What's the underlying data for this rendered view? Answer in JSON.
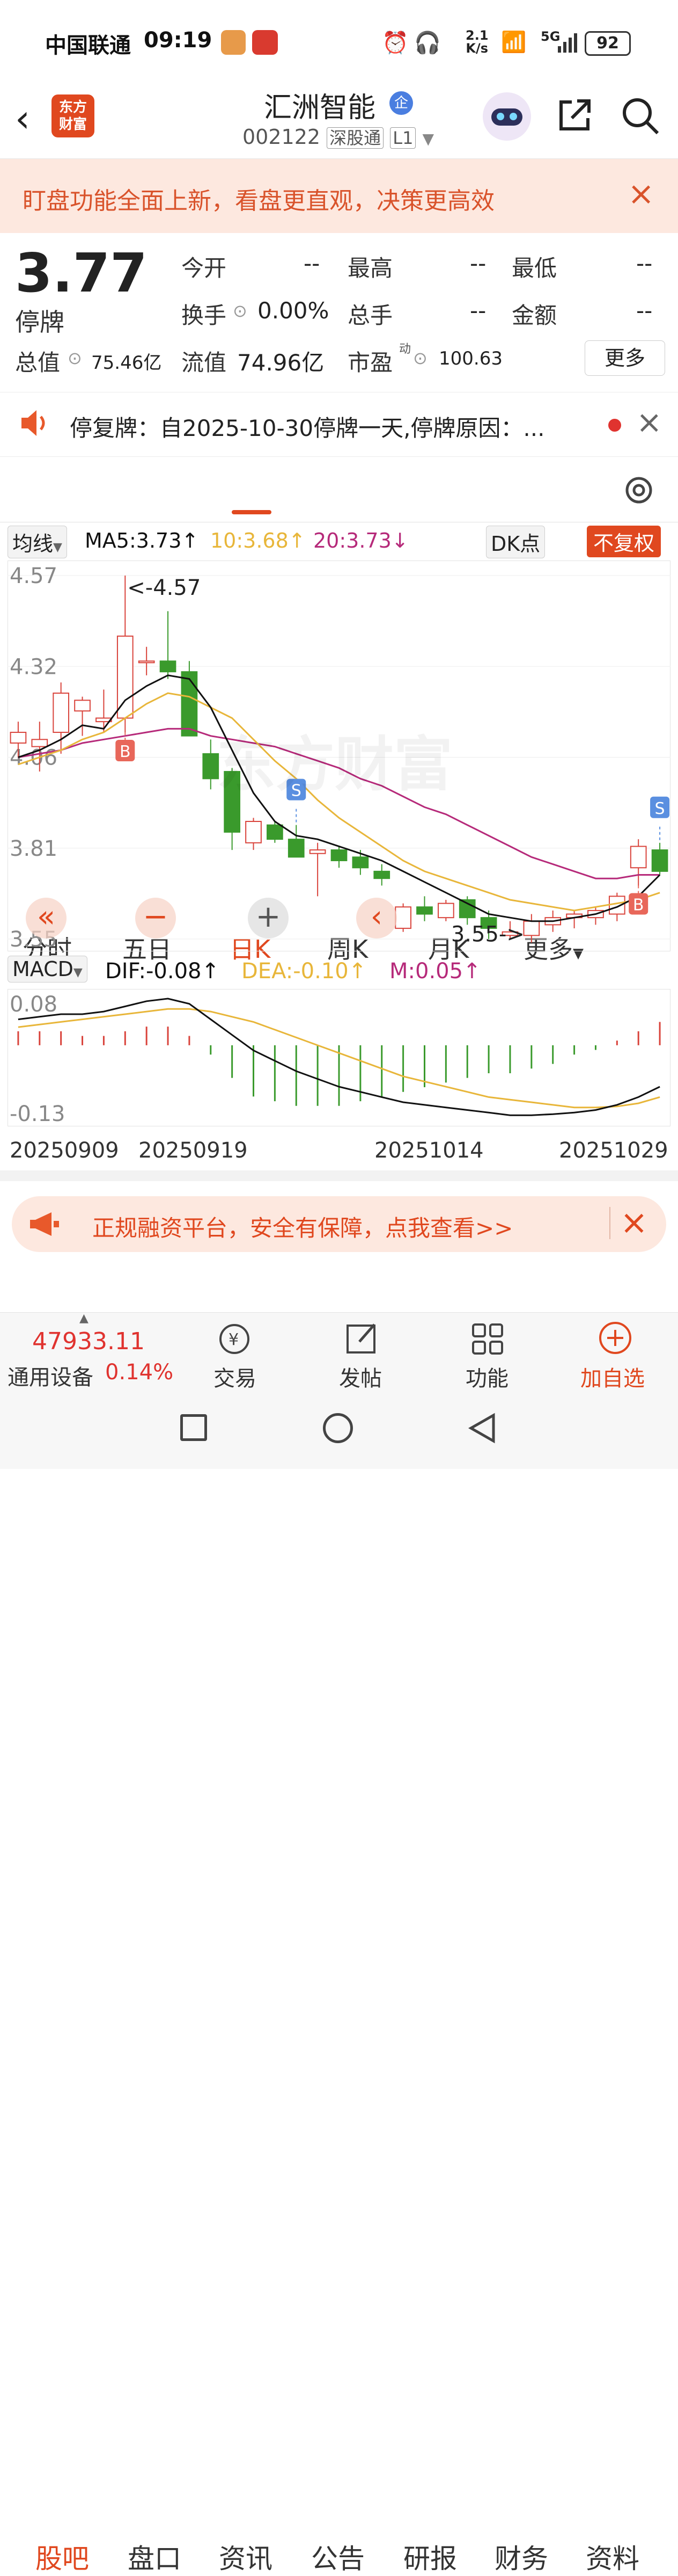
{
  "status_bar": {
    "carrier": "中国联通",
    "time": "09:19",
    "net_speed_value": "2.1",
    "net_speed_unit": "K/s",
    "network": "5G",
    "battery": "92"
  },
  "header": {
    "logo_line1": "东方",
    "logo_line2": "财富",
    "stock_name": "汇洲智能",
    "badge": "企",
    "stock_code": "002122",
    "tag_connect": "深股通",
    "tag_level": "L1"
  },
  "banner": {
    "text": "盯盘功能全面上新，看盘更直观，决策更高效"
  },
  "quote": {
    "price": "3.77",
    "status": "停牌",
    "open_label": "今开",
    "open_value": "--",
    "high_label": "最高",
    "high_value": "--",
    "low_label": "最低",
    "low_value": "--",
    "turnover_label": "换手",
    "turnover_value": "0.00%",
    "volume_label": "总手",
    "volume_value": "--",
    "amount_label": "金额",
    "amount_value": "--",
    "mktcap_label": "总值",
    "mktcap_value": "75.46亿",
    "float_label": "流值",
    "float_value": "74.96亿",
    "pe_label": "市盈",
    "pe_sup": "动",
    "pe_value": "100.63",
    "more_button": "更多"
  },
  "announcement": {
    "text": "停复牌：自2025-10-30停牌一天,停牌原因：..."
  },
  "tabs": [
    "分时",
    "五日",
    "日K",
    "周K",
    "月K",
    "更多"
  ],
  "active_tab": "日K",
  "ma": {
    "selector": "均线",
    "ma5": "MA5:3.73",
    "ma10": "10:3.68",
    "ma20": "20:3.73",
    "dk_button": "DK点",
    "adjust_button": "不复权"
  },
  "colors": {
    "up": "#d9433b",
    "down": "#3a9a2c",
    "ma5": "#111111",
    "ma10": "#e8b63a",
    "ma20": "#b62a7a",
    "accent": "#e0481f"
  },
  "chart_data": [
    {
      "type": "candlestick",
      "y_ticks": [
        "4.57",
        "4.32",
        "4.06",
        "3.81",
        "3.55"
      ],
      "ylim": [
        3.55,
        4.57
      ],
      "annotations": {
        "high_label": "<-4.57",
        "low_label": "3.55->"
      },
      "markers": [
        "B",
        "S",
        "S",
        "B"
      ],
      "candles": [
        {
          "o": 4.1,
          "h": 4.16,
          "l": 4.06,
          "c": 4.13
        },
        {
          "o": 4.09,
          "h": 4.16,
          "l": 4.02,
          "c": 4.11
        },
        {
          "o": 4.13,
          "h": 4.27,
          "l": 4.07,
          "c": 4.24
        },
        {
          "o": 4.19,
          "h": 4.23,
          "l": 4.12,
          "c": 4.22
        },
        {
          "o": 4.16,
          "h": 4.25,
          "l": 4.13,
          "c": 4.17
        },
        {
          "o": 4.17,
          "h": 4.57,
          "l": 4.13,
          "c": 4.4
        },
        {
          "o": 4.33,
          "h": 4.37,
          "l": 4.29,
          "c": 4.33
        },
        {
          "o": 4.33,
          "h": 4.47,
          "l": 4.28,
          "c": 4.3
        },
        {
          "o": 4.3,
          "h": 4.33,
          "l": 4.14,
          "c": 4.12
        },
        {
          "o": 4.07,
          "h": 4.11,
          "l": 3.97,
          "c": 4.0
        },
        {
          "o": 4.02,
          "h": 4.03,
          "l": 3.8,
          "c": 3.85
        },
        {
          "o": 3.82,
          "h": 3.89,
          "l": 3.8,
          "c": 3.88
        },
        {
          "o": 3.87,
          "h": 3.88,
          "l": 3.82,
          "c": 3.83
        },
        {
          "o": 3.83,
          "h": 3.87,
          "l": 3.79,
          "c": 3.78
        },
        {
          "o": 3.79,
          "h": 3.82,
          "l": 3.67,
          "c": 3.8
        },
        {
          "o": 3.8,
          "h": 3.81,
          "l": 3.75,
          "c": 3.77
        },
        {
          "o": 3.78,
          "h": 3.8,
          "l": 3.73,
          "c": 3.75
        },
        {
          "o": 3.74,
          "h": 3.76,
          "l": 3.7,
          "c": 3.72
        },
        {
          "o": 3.58,
          "h": 3.65,
          "l": 3.57,
          "c": 3.64
        },
        {
          "o": 3.64,
          "h": 3.67,
          "l": 3.6,
          "c": 3.62
        },
        {
          "o": 3.61,
          "h": 3.66,
          "l": 3.6,
          "c": 3.65
        },
        {
          "o": 3.66,
          "h": 3.67,
          "l": 3.59,
          "c": 3.61
        },
        {
          "o": 3.61,
          "h": 3.63,
          "l": 3.55,
          "c": 3.58
        },
        {
          "o": 3.56,
          "h": 3.6,
          "l": 3.55,
          "c": 3.57
        },
        {
          "o": 3.56,
          "h": 3.62,
          "l": 3.54,
          "c": 3.6
        },
        {
          "o": 3.59,
          "h": 3.63,
          "l": 3.57,
          "c": 3.61
        },
        {
          "o": 3.61,
          "h": 3.63,
          "l": 3.58,
          "c": 3.62
        },
        {
          "o": 3.61,
          "h": 3.64,
          "l": 3.59,
          "c": 3.63
        },
        {
          "o": 3.62,
          "h": 3.68,
          "l": 3.6,
          "c": 3.67
        },
        {
          "o": 3.75,
          "h": 3.83,
          "l": 3.7,
          "c": 3.81
        },
        {
          "o": 3.8,
          "h": 3.82,
          "l": 3.73,
          "c": 3.74
        }
      ],
      "ma5": [
        4.06,
        4.08,
        4.11,
        4.15,
        4.14,
        4.22,
        4.26,
        4.29,
        4.28,
        4.2,
        4.08,
        3.96,
        3.88,
        3.84,
        3.83,
        3.81,
        3.79,
        3.77,
        3.74,
        3.71,
        3.68,
        3.65,
        3.62,
        3.61,
        3.6,
        3.6,
        3.61,
        3.62,
        3.64,
        3.67,
        3.73
      ],
      "ma10": [
        4.04,
        4.06,
        4.08,
        4.11,
        4.13,
        4.17,
        4.21,
        4.24,
        4.23,
        4.2,
        4.17,
        4.11,
        4.05,
        4.0,
        3.94,
        3.89,
        3.85,
        3.81,
        3.77,
        3.74,
        3.72,
        3.7,
        3.68,
        3.66,
        3.65,
        3.64,
        3.63,
        3.64,
        3.65,
        3.66,
        3.68
      ],
      "ma20": [
        4.06,
        4.07,
        4.08,
        4.1,
        4.11,
        4.12,
        4.13,
        4.14,
        4.14,
        4.12,
        4.11,
        4.1,
        4.09,
        4.07,
        4.05,
        4.03,
        4.0,
        3.98,
        3.95,
        3.92,
        3.9,
        3.87,
        3.84,
        3.81,
        3.78,
        3.76,
        3.74,
        3.72,
        3.72,
        3.73,
        3.73
      ]
    },
    {
      "type": "macd",
      "selector": "MACD",
      "dif_label": "DIF:-0.08",
      "dea_label": "DEA:-0.10",
      "m_label": "M:0.05",
      "y_ticks": [
        "0.08",
        "-0.13"
      ],
      "ylim": [
        -0.14,
        0.09
      ],
      "dates": [
        "20250909",
        "20250919",
        "20251014",
        "20251029"
      ],
      "dif": [
        0.05,
        0.055,
        0.06,
        0.06,
        0.065,
        0.075,
        0.085,
        0.09,
        0.08,
        0.05,
        0.02,
        -0.01,
        -0.03,
        -0.05,
        -0.065,
        -0.08,
        -0.09,
        -0.1,
        -0.11,
        -0.115,
        -0.12,
        -0.125,
        -0.13,
        -0.135,
        -0.135,
        -0.133,
        -0.13,
        -0.125,
        -0.115,
        -0.1,
        -0.08
      ],
      "dea": [
        0.035,
        0.04,
        0.045,
        0.05,
        0.055,
        0.06,
        0.065,
        0.07,
        0.07,
        0.065,
        0.055,
        0.045,
        0.03,
        0.015,
        0.0,
        -0.015,
        -0.03,
        -0.045,
        -0.06,
        -0.07,
        -0.08,
        -0.09,
        -0.1,
        -0.105,
        -0.11,
        -0.115,
        -0.12,
        -0.12,
        -0.118,
        -0.112,
        -0.1
      ],
      "hist": [
        0.03,
        0.03,
        0.03,
        0.02,
        0.02,
        0.03,
        0.04,
        0.04,
        0.02,
        -0.02,
        -0.07,
        -0.11,
        -0.12,
        -0.13,
        -0.13,
        -0.13,
        -0.12,
        -0.11,
        -0.1,
        -0.09,
        -0.08,
        -0.07,
        -0.06,
        -0.06,
        -0.05,
        -0.04,
        -0.02,
        -0.01,
        0.01,
        0.03,
        0.05
      ]
    }
  ],
  "chart_controls": {
    "left_arrows": "«",
    "zoom_out": "−",
    "zoom_in": "+",
    "prev": "‹"
  },
  "promo": {
    "text": "正规融资平台，安全有保障，点我查看>>"
  },
  "bottom_tabs": [
    "股吧",
    "盘口",
    "资讯",
    "公告",
    "研报",
    "财务",
    "资料"
  ],
  "bottom_bar": {
    "index_value": "47933.11",
    "index_name": "通用设备",
    "index_change": "0.14%",
    "trade": "交易",
    "post": "发帖",
    "function": "功能",
    "add_fav": "加自选"
  },
  "watermark": "东方财富"
}
